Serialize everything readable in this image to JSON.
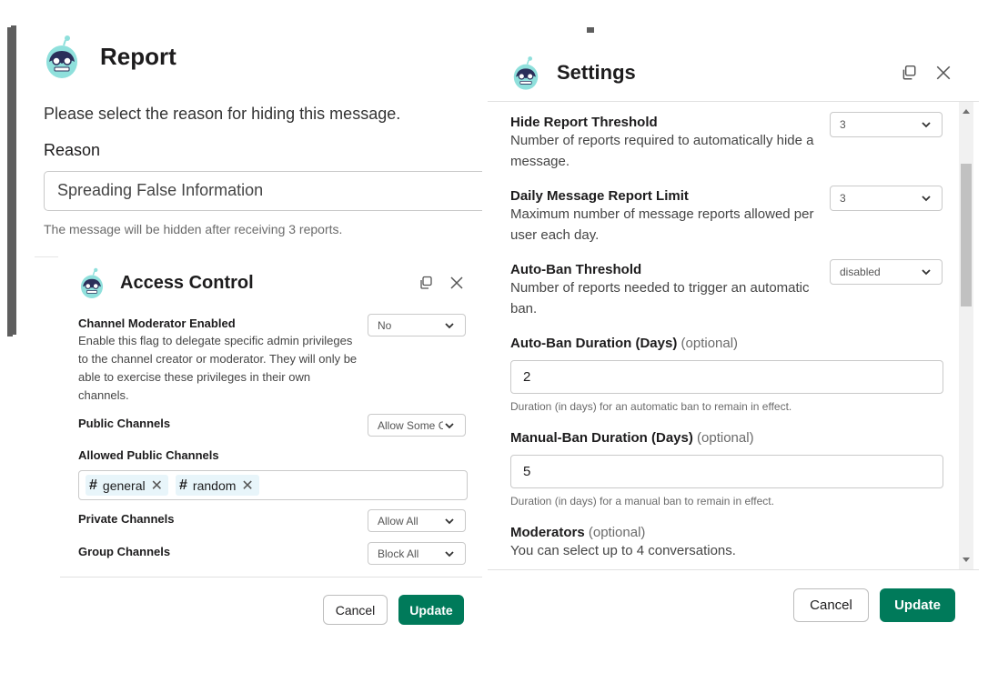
{
  "icons": {
    "app_avatar": "robot-avatar-icon",
    "copy": "copy-icon",
    "close": "close-icon",
    "chevron": "chevron-down-icon",
    "hash": "hash-icon",
    "remove": "remove-x-icon"
  },
  "colors": {
    "primary_button": "#007a5a",
    "avatar": "#8fe0dc",
    "chip_bg": "#e8f5fa"
  },
  "report": {
    "title": "Report",
    "prompt": "Please select the reason for hiding this message.",
    "reason_label": "Reason",
    "reason_value": "Spreading False Information",
    "hint": "The message will be hidden after receiving 3 reports."
  },
  "access_control": {
    "title": "Access Control",
    "channel_moderator": {
      "label": "Channel Moderator Enabled",
      "description": "Enable this flag to delegate specific admin privileges to the channel creator or moderator. They will only be able to exercise these privileges in their own channels.",
      "value": "No"
    },
    "public_channels": {
      "label": "Public Channels",
      "value": "Allow Some Ch"
    },
    "allowed_public_channels": {
      "label": "Allowed Public Channels",
      "chips": [
        "general",
        "random"
      ]
    },
    "private_channels": {
      "label": "Private Channels",
      "value": "Allow All"
    },
    "group_channels": {
      "label": "Group Channels",
      "value": "Block All"
    },
    "cancel_label": "Cancel",
    "update_label": "Update"
  },
  "settings": {
    "title": "Settings",
    "hide_report_threshold": {
      "label": "Hide Report Threshold",
      "description": "Number of reports required to automatically hide a message.",
      "value": "3"
    },
    "daily_report_limit": {
      "label": "Daily Message Report Limit",
      "description": "Maximum number of message reports allowed per user each day.",
      "value": "3"
    },
    "auto_ban_threshold": {
      "label": "Auto-Ban Threshold",
      "description": "Number of reports needed to trigger an automatic ban.",
      "value": "disabled"
    },
    "auto_ban_duration": {
      "label": "Auto-Ban Duration (Days)",
      "optional": "(optional)",
      "value": "2",
      "hint": "Duration (in days) for an automatic ban to remain in effect."
    },
    "manual_ban_duration": {
      "label": "Manual-Ban Duration (Days)",
      "optional": "(optional)",
      "value": "5",
      "hint": "Duration (in days) for a manual ban to remain in effect."
    },
    "moderators": {
      "label": "Moderators",
      "optional": "(optional)",
      "description": "You can select up to 4 conversations."
    },
    "cancel_label": "Cancel",
    "update_label": "Update"
  }
}
